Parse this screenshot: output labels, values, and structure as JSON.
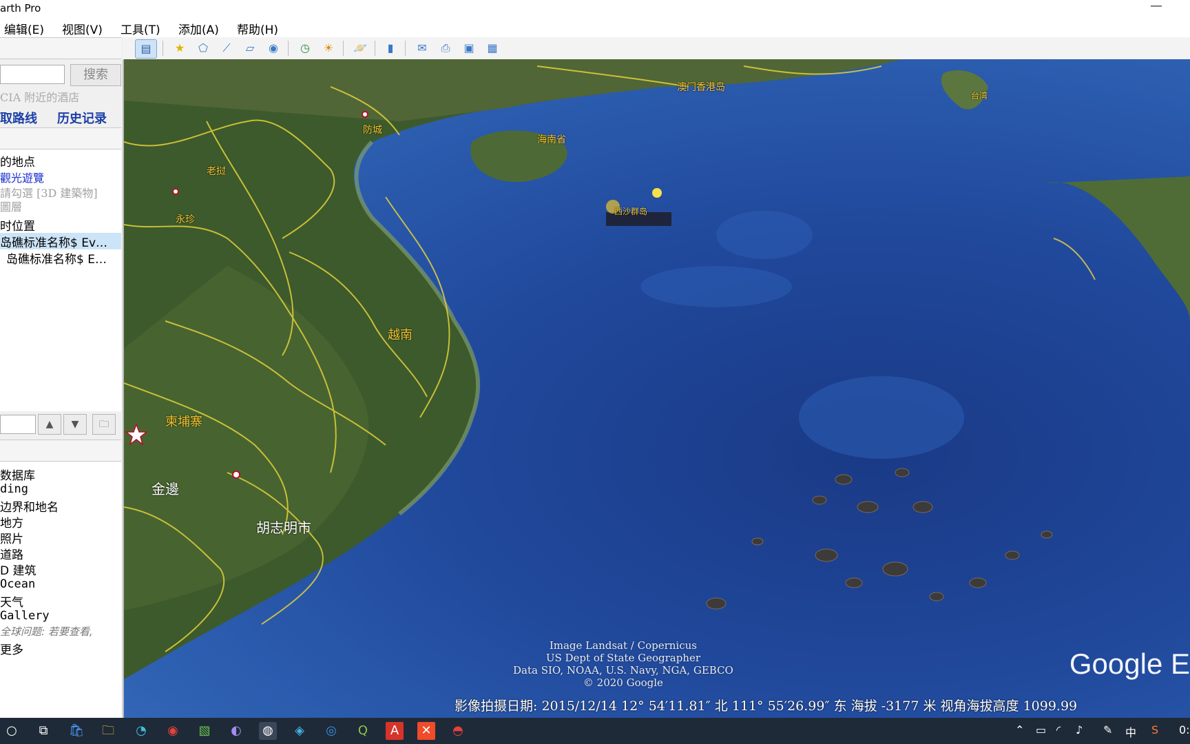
{
  "window": {
    "title": "arth Pro",
    "minimize_glyph": "—"
  },
  "menu": [
    "编辑(E)",
    "视图(V)",
    "工具(T)",
    "添加(A)",
    "帮助(H)"
  ],
  "search": {
    "button": "搜索",
    "hint": "CIA 附近的酒店",
    "get_directions": "取路线",
    "history": "历史记录"
  },
  "places": [
    "的地点",
    "觀光遊覽",
    "請勾選 [3D 建築物]",
    "圖層",
    "时位置",
    "岛礁标准名称$ Ev…",
    "岛礁标准名称$ E…"
  ],
  "layers": [
    "数据库",
    "ding",
    "边界和地名",
    "地方",
    "照片",
    "道路",
    "D 建筑",
    "Ocean",
    "天气",
    "Gallery",
    "全球问题: 若要查看,",
    "更多"
  ],
  "toolbar_icons": [
    "sidebar-toggle-icon",
    "placemark-icon",
    "polygon-icon",
    "path-icon",
    "overlay-icon",
    "tour-icon",
    "history-icon",
    "sun-icon",
    "planet-icon",
    "ruler-icon",
    "email-icon",
    "print-icon",
    "save-image-icon",
    "maps-icon"
  ],
  "map_labels": {
    "macau_hk": "澳门香港岛",
    "hainan": "海南省",
    "guangxi": "防城",
    "laos": "老挝",
    "vientiane": "永珍",
    "vietnam": "越南",
    "cambodia": "柬埔寨",
    "phnom_penh": "金邊",
    "hcmc": "胡志明市",
    "taiwan": "台湾",
    "islands": "西沙群岛"
  },
  "attribution": [
    "Image Landsat / Copernicus",
    "US Dept of State Geographer",
    "Data SIO, NOAA, U.S. Navy, NGA, GEBCO",
    "© 2020 Google"
  ],
  "google_logo": "Google E",
  "status_bar": "影像拍摄日期: 2015/12/14    12° 54′11.81″ 北 111° 55′26.99″ 东 海拔 -3177 米    视角海拔高度 1099.99",
  "taskbar_icons": [
    "search-icon",
    "task-view-icon",
    "store-icon",
    "explorer-icon",
    "edge-icon",
    "chrome-icon",
    "photos-icon",
    "media-icon",
    "google-earth-icon",
    "maps-app-icon",
    "app-icon",
    "qgis-icon",
    "adobe-icon",
    "xmind-icon",
    "remote-icon"
  ],
  "tray": {
    "ime": "中",
    "clock": "0:"
  }
}
